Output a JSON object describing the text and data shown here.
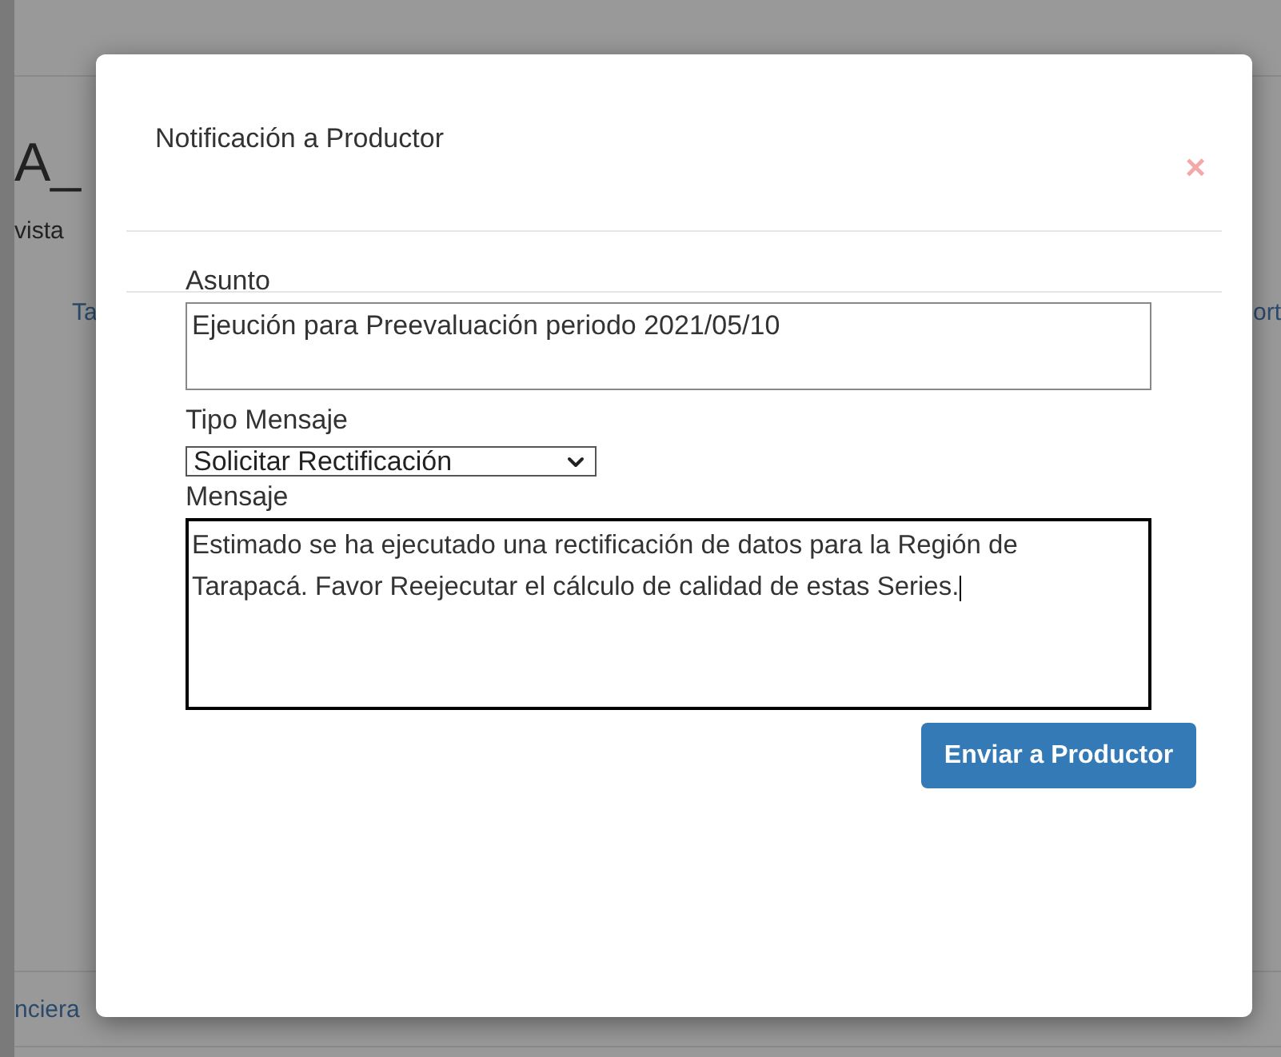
{
  "background_page": {
    "heading": "A_",
    "subtitle": "vista",
    "tab_left": "Ta",
    "tab_right": "ort",
    "footer_link": "nciera"
  },
  "dialog": {
    "title": "Notificación a Productor",
    "close": "×",
    "subject": {
      "label": "Asunto",
      "value": "Ejeución para Preevaluación periodo 2021/05/10"
    },
    "message_type": {
      "label": "Tipo Mensaje",
      "value": "Solicitar Rectificación"
    },
    "message": {
      "label": "Mensaje",
      "value": "Estimado se ha ejecutado una rectificación de datos para la Región de Tarapacá. Favor Reejecutar el cálculo de calidad de estas Series.",
      "focused": true
    },
    "send_button": "Enviar a Productor"
  }
}
